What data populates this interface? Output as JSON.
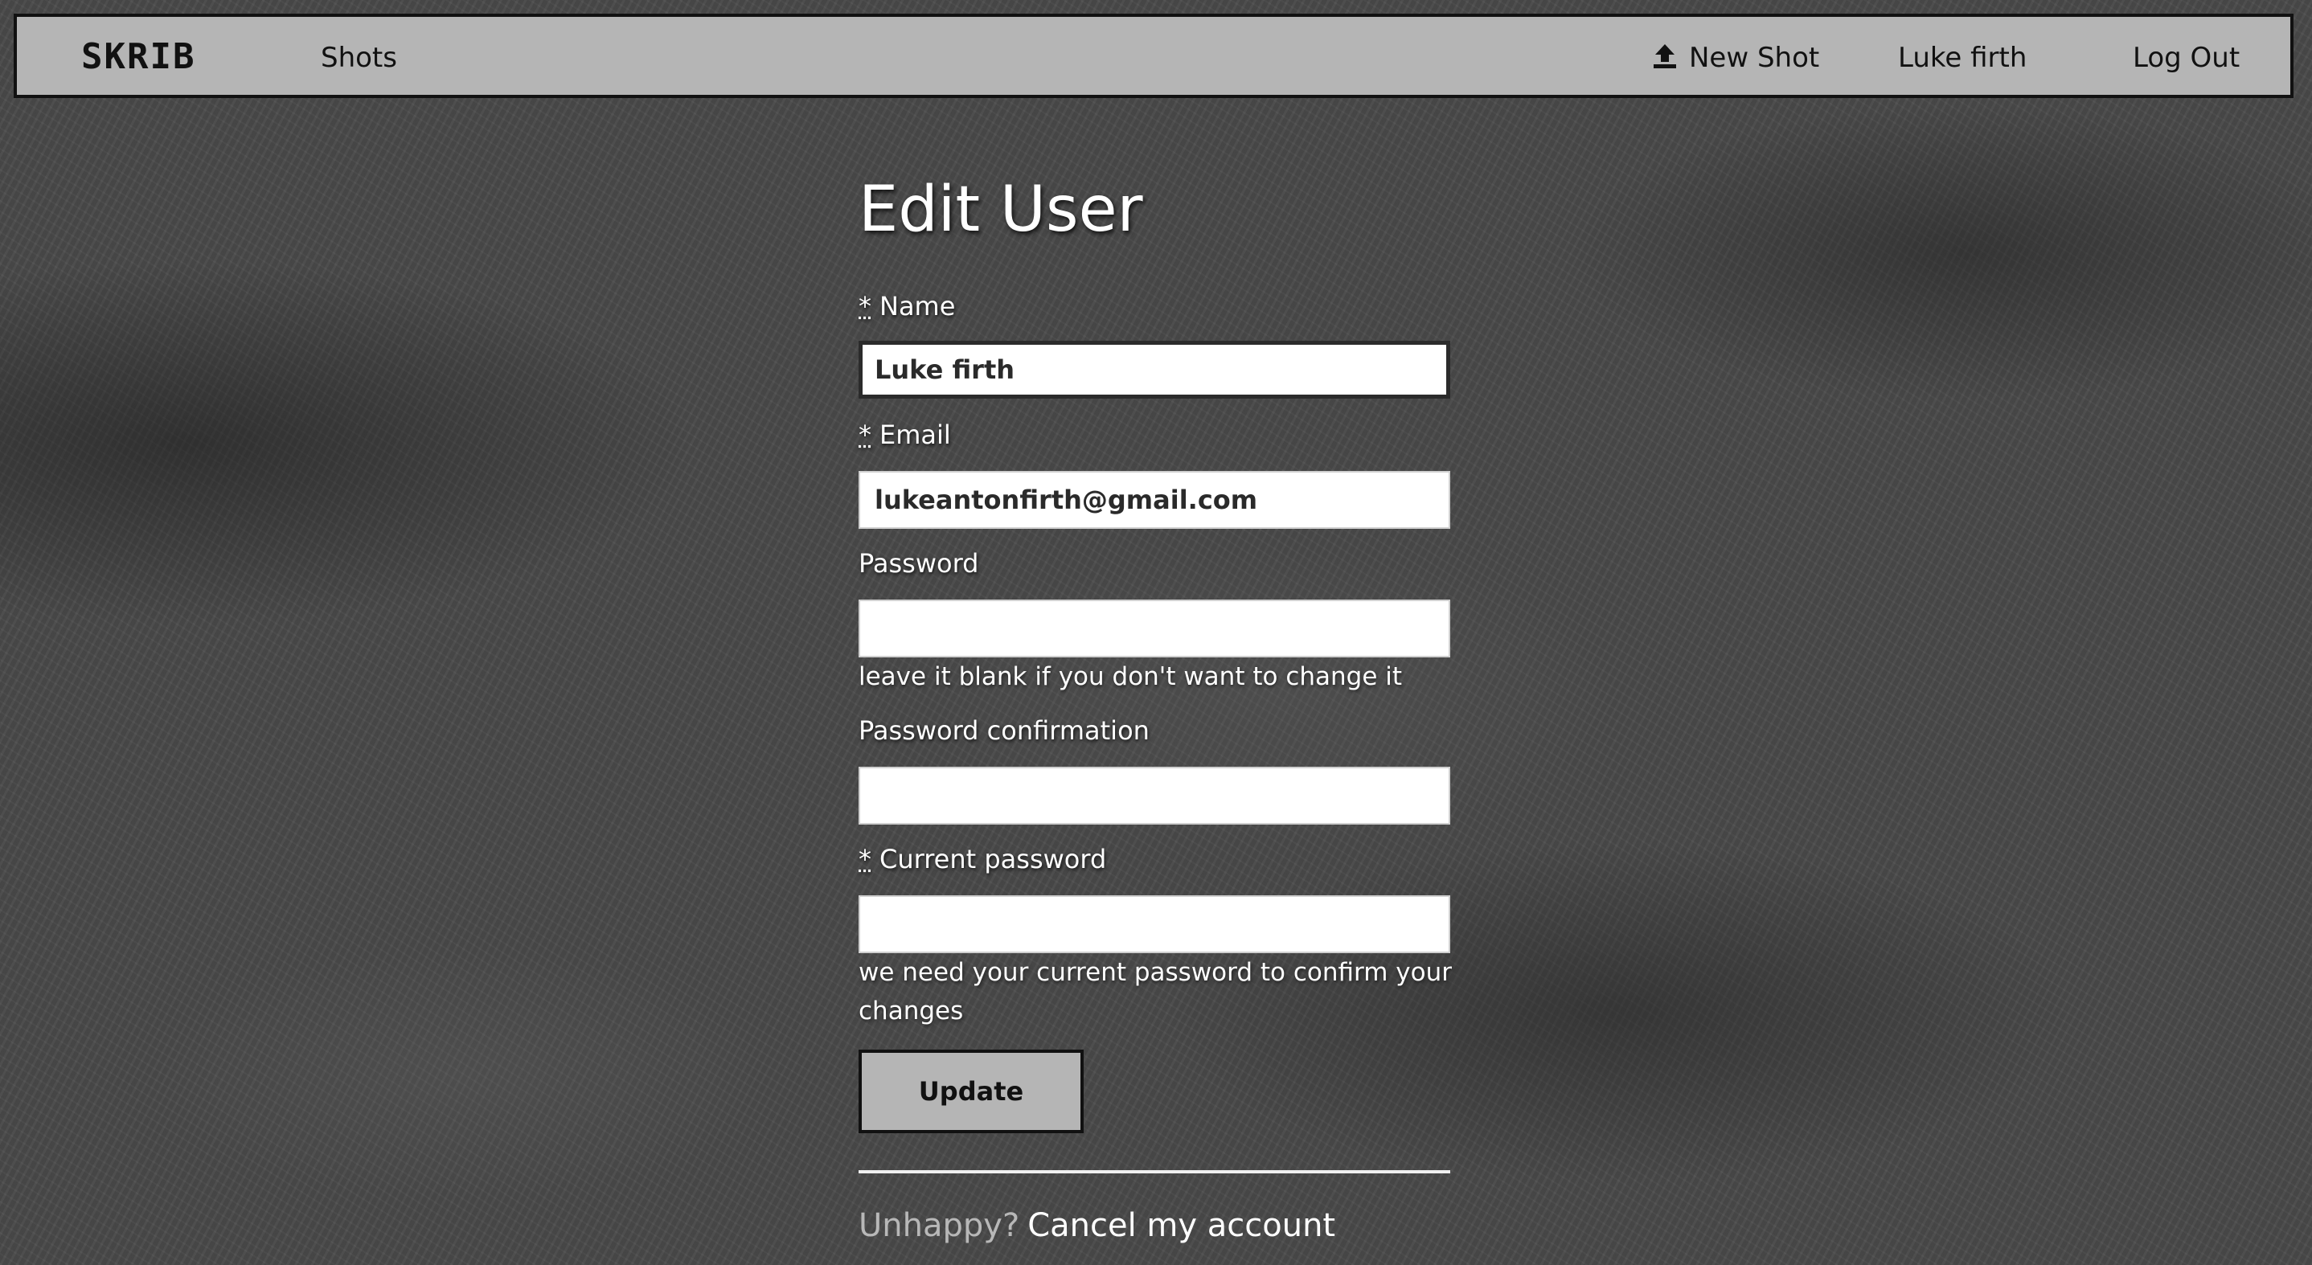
{
  "nav": {
    "logo": "SKRIB",
    "shots": "Shots",
    "new_shot": "New Shot",
    "user": "Luke firth",
    "logout": "Log Out",
    "icons": {
      "new_shot": "upload-icon"
    }
  },
  "page": {
    "title": "Edit User"
  },
  "form": {
    "required_mark": "*",
    "name": {
      "label": "Name",
      "value": "Luke firth"
    },
    "email": {
      "label": "Email",
      "value": "lukeantonfirth@gmail.com"
    },
    "password": {
      "label": "Password",
      "value": "",
      "hint": "leave it blank if you don't want to change it"
    },
    "password_confirmation": {
      "label": "Password confirmation",
      "value": ""
    },
    "current_password": {
      "label": "Current password",
      "value": "",
      "hint": "we need your current password to confirm your changes"
    },
    "submit": "Update"
  },
  "footer": {
    "unhappy": "Unhappy?",
    "cancel_account": "Cancel my account"
  },
  "colors": {
    "nav_bg": "#b5b5b5",
    "nav_border": "#111111",
    "page_bg": "#4a4a4a",
    "text": "#ffffff",
    "muted": "#b8b8b8"
  }
}
